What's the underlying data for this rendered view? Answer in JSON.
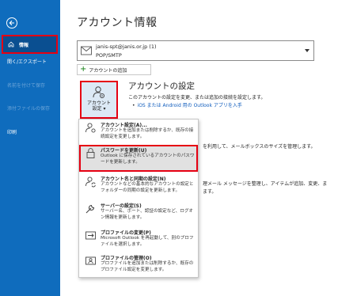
{
  "sidebar": {
    "items": [
      {
        "label": "情報"
      },
      {
        "label": "開く/エクスポート"
      },
      {
        "label": "名前を付けて保存"
      },
      {
        "label": "添付ファイルの保存"
      },
      {
        "label": "印刷"
      }
    ]
  },
  "main": {
    "title": "アカウント情報",
    "account": {
      "email": "janis-spt@janis.or.jp (1)",
      "type": "POP/SMTP"
    },
    "add_account_label": "アカウントの追加",
    "settings_button": {
      "line1": "アカウント",
      "line2": "設定 ▾"
    },
    "section": {
      "title": "アカウントの設定",
      "description": "このアカウントの設定を変更、または追加の接続を設定します。",
      "link": "iOS または Android 用の Outlook アプリを入手"
    },
    "bg_texts": [
      "を利用して、メールボックスのサイズを管理します。",
      "理メール メッセージを整理し、アイテムが追加、変更、ま",
      "ます。"
    ]
  },
  "menu": {
    "items": [
      {
        "title": "アカウント設定(A)...",
        "desc": "アカウントを追加または削除するか、既存の接続設定を変更します。"
      },
      {
        "title": "パスワードを更新(U)",
        "desc": "Outlook に保存されているアカウントのパスワードを更新します。"
      },
      {
        "title": "アカウント名と同期の設定(N)",
        "desc": "アカウントなどの基本的なアカウントの設定とフォルダーの同期の設定を更新します。"
      },
      {
        "title": "サーバーの設定(S)",
        "desc": "サーバー名、ポート、認証の設定など、ログオン情報を更新します。"
      },
      {
        "title": "プロファイルの変更(P)",
        "desc": "Microsoft Outlook を再起動して、別のプロファイルを選択します。"
      },
      {
        "title": "プロファイルの管理(O)",
        "desc": "プロファイルを追加または削除するか、既存のプロファイル設定を変更します。"
      }
    ]
  }
}
